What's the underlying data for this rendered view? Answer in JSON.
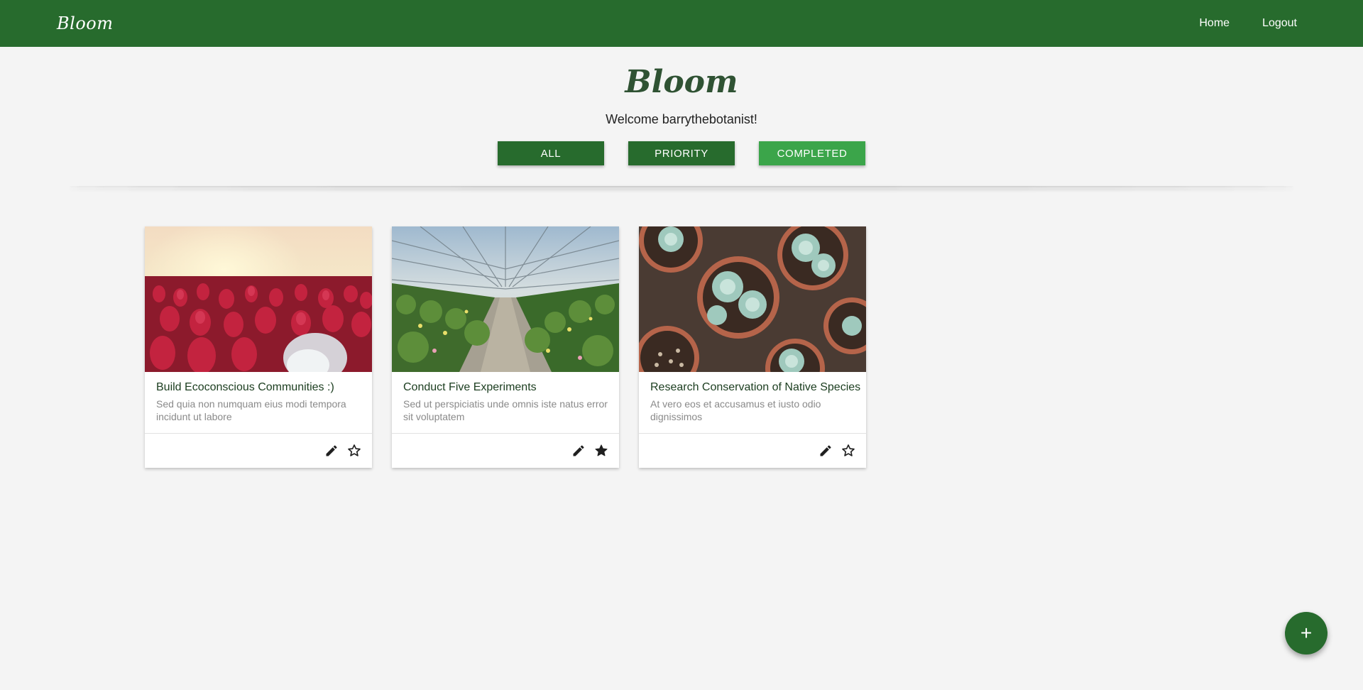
{
  "navbar": {
    "brand": "Bloom",
    "links": [
      {
        "label": "Home"
      },
      {
        "label": "Logout"
      }
    ]
  },
  "hero": {
    "title": "Bloom",
    "welcome": "Welcome barrythebotanist!"
  },
  "filters": {
    "all": "ALL",
    "priority": "PRIORITY",
    "completed": "COMPLETED",
    "selected": "COMPLETED"
  },
  "cards": [
    {
      "title": "Build Ecoconscious Communities :)",
      "description": "Sed quia non numquam eius modi tempora incidunt ut labore",
      "image_icon": "red-tulips-image",
      "starred": false
    },
    {
      "title": "Conduct Five Experiments",
      "description": "Sed ut perspiciatis unde omnis iste natus error sit voluptatem",
      "image_icon": "greenhouse-image",
      "starred": true
    },
    {
      "title": "Research Conservation of Native Species",
      "description": "At vero eos et accusamus et iusto odio dignissimos",
      "image_icon": "succulents-image",
      "starred": false
    }
  ],
  "fab": {
    "label": "+"
  },
  "colors": {
    "primary": "#276b2d",
    "active_filter": "#3ba54a",
    "title": "#2f5233",
    "background": "#f4f4f4"
  }
}
